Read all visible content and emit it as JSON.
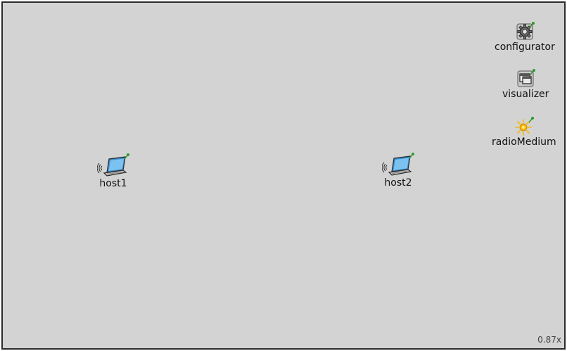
{
  "network": {
    "background_color": "#d3d3d3",
    "border_color": "#2b2b2b",
    "zoom_label": "0.87x"
  },
  "modules": {
    "configurator": {
      "label": "configurator",
      "icon": "gear-icon"
    },
    "visualizer": {
      "label": "visualizer",
      "icon": "window-icon"
    },
    "radioMedium": {
      "label": "radioMedium",
      "icon": "sun-icon"
    },
    "host1": {
      "label": "host1",
      "icon": "laptop-wireless-icon"
    },
    "host2": {
      "label": "host2",
      "icon": "laptop-wireless-icon"
    }
  },
  "colors": {
    "pin_green": "#2e9a2e",
    "laptop_screen": "#3a8fd0",
    "sun_yellow": "#f5b800"
  }
}
